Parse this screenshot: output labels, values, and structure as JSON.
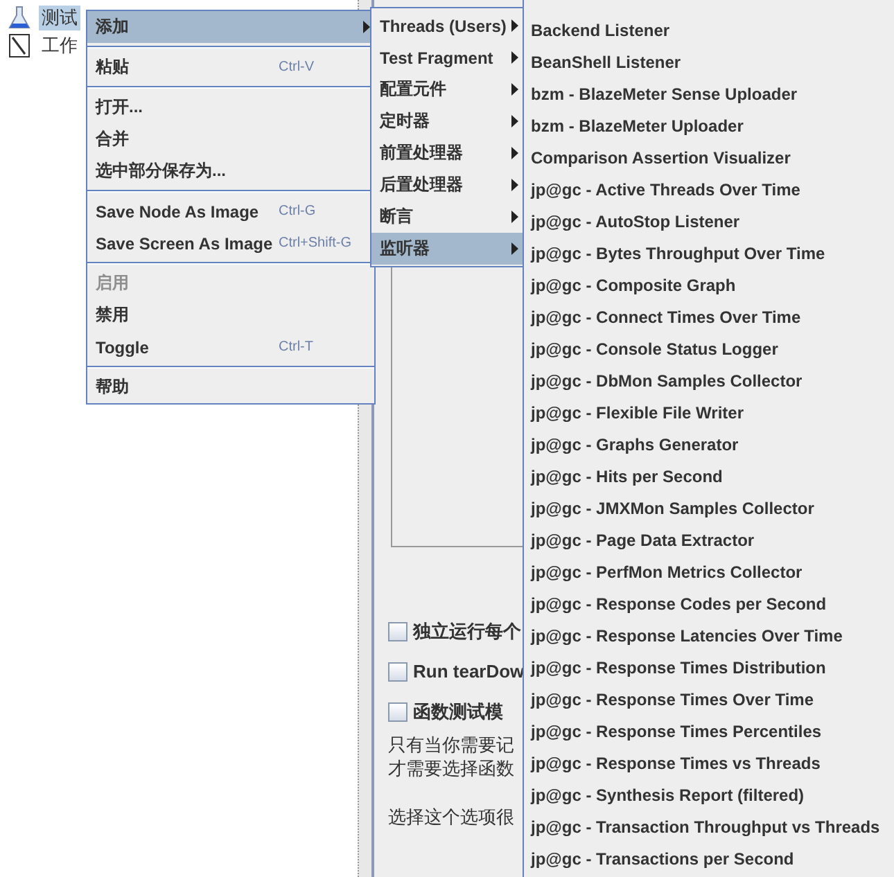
{
  "tree": {
    "items": [
      {
        "label": "测试",
        "kind": "flask",
        "selected": true
      },
      {
        "label": "工作",
        "kind": "notepad",
        "selected": false
      }
    ]
  },
  "panel": {
    "checkboxes": [
      {
        "label": "独立运行每个",
        "checked": false
      },
      {
        "label": "Run tearDow",
        "checked": false
      },
      {
        "label": "函数测试模",
        "checked": false
      }
    ],
    "notes": [
      "只有当你需要记",
      "才需要选择函数",
      "选择这个选项很"
    ]
  },
  "context_menu": {
    "items": [
      {
        "kind": "item",
        "label": "添加",
        "selected": true,
        "disabled": false,
        "submenu": true
      },
      {
        "kind": "separator"
      },
      {
        "kind": "item",
        "label": "粘贴",
        "shortcut": "Ctrl-V",
        "selected": false,
        "disabled": false,
        "submenu": false
      },
      {
        "kind": "separator"
      },
      {
        "kind": "item",
        "label": "打开...",
        "selected": false,
        "disabled": false,
        "submenu": false
      },
      {
        "kind": "item",
        "label": "合并",
        "selected": false,
        "disabled": false,
        "submenu": false
      },
      {
        "kind": "item",
        "label": "选中部分保存为...",
        "selected": false,
        "disabled": false,
        "submenu": false
      },
      {
        "kind": "separator"
      },
      {
        "kind": "item",
        "label": "Save Node As Image",
        "shortcut": "Ctrl-G",
        "selected": false,
        "disabled": false,
        "submenu": false
      },
      {
        "kind": "item",
        "label": "Save Screen As Image",
        "shortcut": "Ctrl+Shift-G",
        "selected": false,
        "disabled": false,
        "submenu": false
      },
      {
        "kind": "separator"
      },
      {
        "kind": "item",
        "label": "启用",
        "selected": false,
        "disabled": true,
        "submenu": false
      },
      {
        "kind": "item",
        "label": "禁用",
        "selected": false,
        "disabled": false,
        "submenu": false
      },
      {
        "kind": "item",
        "label": "Toggle",
        "shortcut": "Ctrl-T",
        "selected": false,
        "disabled": false,
        "submenu": false
      },
      {
        "kind": "separator"
      },
      {
        "kind": "item",
        "label": "帮助",
        "selected": false,
        "disabled": false,
        "submenu": false
      }
    ]
  },
  "add_submenu": {
    "items": [
      {
        "label": "Threads (Users)",
        "selected": false
      },
      {
        "label": "Test Fragment",
        "selected": false
      },
      {
        "label": "配置元件",
        "selected": false
      },
      {
        "label": "定时器",
        "selected": false
      },
      {
        "label": "前置处理器",
        "selected": false
      },
      {
        "label": "后置处理器",
        "selected": false
      },
      {
        "label": "断言",
        "selected": false
      },
      {
        "label": "监听器",
        "selected": true
      }
    ]
  },
  "listener_submenu": {
    "items": [
      "Backend Listener",
      "BeanShell Listener",
      "bzm - BlazeMeter Sense Uploader",
      "bzm - BlazeMeter Uploader",
      "Comparison Assertion Visualizer",
      "jp@gc - Active Threads Over Time",
      "jp@gc - AutoStop Listener",
      "jp@gc - Bytes Throughput Over Time",
      "jp@gc - Composite Graph",
      "jp@gc - Connect Times Over Time",
      "jp@gc - Console Status Logger",
      "jp@gc - DbMon Samples Collector",
      "jp@gc - Flexible File Writer",
      "jp@gc - Graphs Generator",
      "jp@gc - Hits per Second",
      "jp@gc - JMXMon Samples Collector",
      "jp@gc - Page Data Extractor",
      "jp@gc - PerfMon Metrics Collector",
      "jp@gc - Response Codes per Second",
      "jp@gc - Response Latencies Over Time",
      "jp@gc - Response Times Distribution",
      "jp@gc - Response Times Over Time",
      "jp@gc - Response Times Percentiles",
      "jp@gc - Response Times vs Threads",
      "jp@gc - Synthesis Report (filtered)",
      "jp@gc - Transaction Throughput vs Threads",
      "jp@gc - Transactions per Second"
    ]
  }
}
